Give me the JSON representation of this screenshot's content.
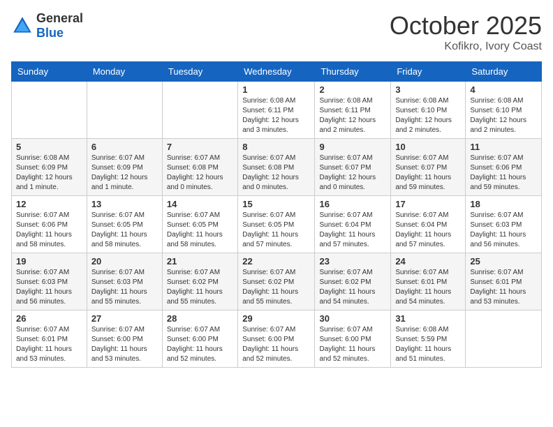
{
  "logo": {
    "general": "General",
    "blue": "Blue"
  },
  "title": "October 2025",
  "location": "Kofikro, Ivory Coast",
  "days_of_week": [
    "Sunday",
    "Monday",
    "Tuesday",
    "Wednesday",
    "Thursday",
    "Friday",
    "Saturday"
  ],
  "weeks": [
    [
      {
        "day": "",
        "info": ""
      },
      {
        "day": "",
        "info": ""
      },
      {
        "day": "",
        "info": ""
      },
      {
        "day": "1",
        "info": "Sunrise: 6:08 AM\nSunset: 6:11 PM\nDaylight: 12 hours and 3 minutes."
      },
      {
        "day": "2",
        "info": "Sunrise: 6:08 AM\nSunset: 6:11 PM\nDaylight: 12 hours and 2 minutes."
      },
      {
        "day": "3",
        "info": "Sunrise: 6:08 AM\nSunset: 6:10 PM\nDaylight: 12 hours and 2 minutes."
      },
      {
        "day": "4",
        "info": "Sunrise: 6:08 AM\nSunset: 6:10 PM\nDaylight: 12 hours and 2 minutes."
      }
    ],
    [
      {
        "day": "5",
        "info": "Sunrise: 6:08 AM\nSunset: 6:09 PM\nDaylight: 12 hours and 1 minute."
      },
      {
        "day": "6",
        "info": "Sunrise: 6:07 AM\nSunset: 6:09 PM\nDaylight: 12 hours and 1 minute."
      },
      {
        "day": "7",
        "info": "Sunrise: 6:07 AM\nSunset: 6:08 PM\nDaylight: 12 hours and 0 minutes."
      },
      {
        "day": "8",
        "info": "Sunrise: 6:07 AM\nSunset: 6:08 PM\nDaylight: 12 hours and 0 minutes."
      },
      {
        "day": "9",
        "info": "Sunrise: 6:07 AM\nSunset: 6:07 PM\nDaylight: 12 hours and 0 minutes."
      },
      {
        "day": "10",
        "info": "Sunrise: 6:07 AM\nSunset: 6:07 PM\nDaylight: 11 hours and 59 minutes."
      },
      {
        "day": "11",
        "info": "Sunrise: 6:07 AM\nSunset: 6:06 PM\nDaylight: 11 hours and 59 minutes."
      }
    ],
    [
      {
        "day": "12",
        "info": "Sunrise: 6:07 AM\nSunset: 6:06 PM\nDaylight: 11 hours and 58 minutes."
      },
      {
        "day": "13",
        "info": "Sunrise: 6:07 AM\nSunset: 6:05 PM\nDaylight: 11 hours and 58 minutes."
      },
      {
        "day": "14",
        "info": "Sunrise: 6:07 AM\nSunset: 6:05 PM\nDaylight: 11 hours and 58 minutes."
      },
      {
        "day": "15",
        "info": "Sunrise: 6:07 AM\nSunset: 6:05 PM\nDaylight: 11 hours and 57 minutes."
      },
      {
        "day": "16",
        "info": "Sunrise: 6:07 AM\nSunset: 6:04 PM\nDaylight: 11 hours and 57 minutes."
      },
      {
        "day": "17",
        "info": "Sunrise: 6:07 AM\nSunset: 6:04 PM\nDaylight: 11 hours and 57 minutes."
      },
      {
        "day": "18",
        "info": "Sunrise: 6:07 AM\nSunset: 6:03 PM\nDaylight: 11 hours and 56 minutes."
      }
    ],
    [
      {
        "day": "19",
        "info": "Sunrise: 6:07 AM\nSunset: 6:03 PM\nDaylight: 11 hours and 56 minutes."
      },
      {
        "day": "20",
        "info": "Sunrise: 6:07 AM\nSunset: 6:03 PM\nDaylight: 11 hours and 55 minutes."
      },
      {
        "day": "21",
        "info": "Sunrise: 6:07 AM\nSunset: 6:02 PM\nDaylight: 11 hours and 55 minutes."
      },
      {
        "day": "22",
        "info": "Sunrise: 6:07 AM\nSunset: 6:02 PM\nDaylight: 11 hours and 55 minutes."
      },
      {
        "day": "23",
        "info": "Sunrise: 6:07 AM\nSunset: 6:02 PM\nDaylight: 11 hours and 54 minutes."
      },
      {
        "day": "24",
        "info": "Sunrise: 6:07 AM\nSunset: 6:01 PM\nDaylight: 11 hours and 54 minutes."
      },
      {
        "day": "25",
        "info": "Sunrise: 6:07 AM\nSunset: 6:01 PM\nDaylight: 11 hours and 53 minutes."
      }
    ],
    [
      {
        "day": "26",
        "info": "Sunrise: 6:07 AM\nSunset: 6:01 PM\nDaylight: 11 hours and 53 minutes."
      },
      {
        "day": "27",
        "info": "Sunrise: 6:07 AM\nSunset: 6:00 PM\nDaylight: 11 hours and 53 minutes."
      },
      {
        "day": "28",
        "info": "Sunrise: 6:07 AM\nSunset: 6:00 PM\nDaylight: 11 hours and 52 minutes."
      },
      {
        "day": "29",
        "info": "Sunrise: 6:07 AM\nSunset: 6:00 PM\nDaylight: 11 hours and 52 minutes."
      },
      {
        "day": "30",
        "info": "Sunrise: 6:07 AM\nSunset: 6:00 PM\nDaylight: 11 hours and 52 minutes."
      },
      {
        "day": "31",
        "info": "Sunrise: 6:08 AM\nSunset: 5:59 PM\nDaylight: 11 hours and 51 minutes."
      },
      {
        "day": "",
        "info": ""
      }
    ]
  ]
}
